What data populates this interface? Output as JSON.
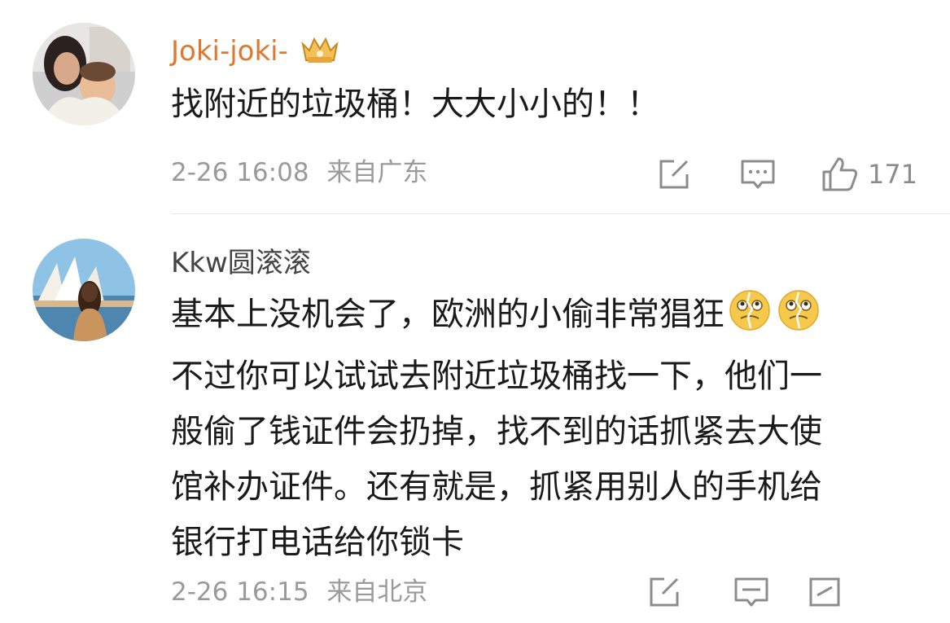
{
  "comments": [
    {
      "username": "Joki-joki-",
      "username_color": "#e0772f",
      "badge_icon": "crown-vip-badge",
      "lines": [
        "找附近的垃圾桶！大大小小的！！"
      ],
      "time": "2-26 16:08",
      "location": "来自广东",
      "actions": {
        "share_icon": "share-icon",
        "reply_icon": "comment-icon",
        "like_icon": "like-icon",
        "like_count": "171"
      }
    },
    {
      "username": "Kkw圆滚滚",
      "username_color": "#444444",
      "lines": [
        "基本上没机会了，欧洲的小偷非常猖狂",
        "不过你可以试试去附近垃圾桶找一下，他们一",
        "般偷了钱证件会扔掉，找不到的话抓紧去大使",
        "馆补办证件。还有就是，抓紧用别人的手机给",
        "银行打电话给你锁卡"
      ],
      "emoji_icons": [
        "broken-heart-face-emoji",
        "broken-heart-face-emoji"
      ],
      "time": "2-26 16:15",
      "location": "来自北京",
      "actions": {
        "share_icon": "share-icon",
        "reply_icon": "comment-icon",
        "like_icon": "like-icon"
      }
    }
  ]
}
